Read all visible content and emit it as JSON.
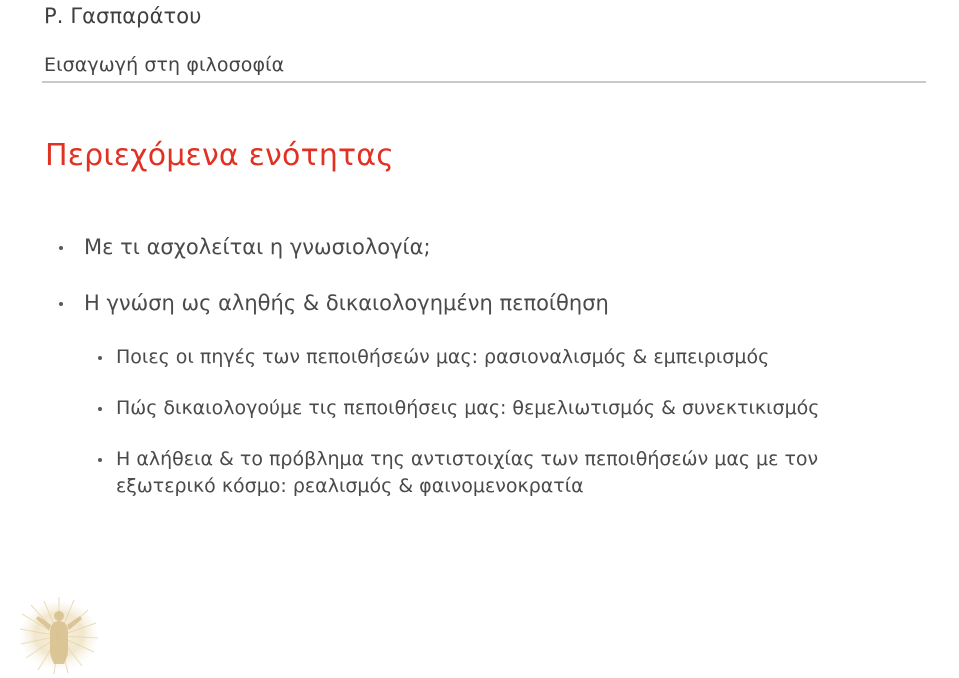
{
  "slide": {
    "header": {
      "author": "Ρ. Γασπαράτου",
      "subject": "Εισαγωγή στη φιλοσοφία"
    },
    "title": "Περιεχόμενα ενότητας",
    "bullets": [
      {
        "level": 1,
        "text": "Με τι ασχολείται η γνωσιολογία;"
      },
      {
        "level": 1,
        "text": "Η γνώση ως αληθής & δικαιολογημένη πεποίθηση"
      },
      {
        "level": 2,
        "text": "Ποιες οι πηγές των πεποιθήσεών μας: ρασιοναλισμός & εμπειρισμός"
      },
      {
        "level": 2,
        "text": "Πώς δικαιολογούμε τις πεποιθήσεις μας: θεμελιωτισμός & συνεκτικισμός"
      },
      {
        "level": 2,
        "text": "Η αλήθεια & το πρόβλημα της αντιστοιχίας των πεποιθήσεών μας με τον",
        "text_continued": "εξωτερικό κόσμο: ρεαλισμός & φαινομενοκρατία"
      }
    ],
    "emblem_label": "university-emblem",
    "colors": {
      "title_red": "#e03123",
      "body_gray": "#4a4a4a",
      "header_gray": "#3f3f3f",
      "rule_gray": "#c8c9cd",
      "emblem_gold": "#c8a44a",
      "background": "#ffffff"
    }
  }
}
